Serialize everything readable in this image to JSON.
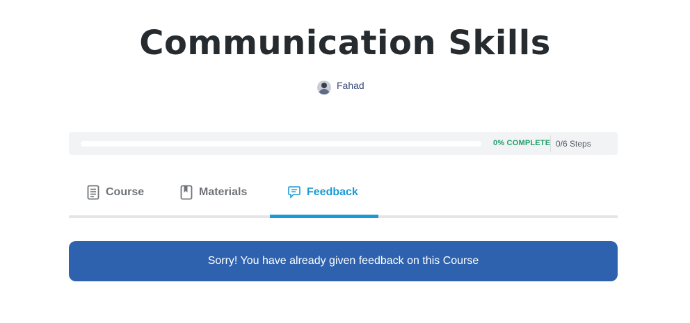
{
  "course": {
    "title": "Communication Skills",
    "author": "Fahad"
  },
  "progress": {
    "percent_label": "0% COMPLETE",
    "percent": 0,
    "steps_label": "0/6 Steps"
  },
  "tabs": [
    {
      "label": "Course",
      "icon": "document-icon",
      "active": false
    },
    {
      "label": "Materials",
      "icon": "book-icon",
      "active": false
    },
    {
      "label": "Feedback",
      "icon": "comment-icon",
      "active": true
    }
  ],
  "notice": {
    "message": "Sorry! You have already given feedback on this Course"
  },
  "colors": {
    "accent": "#1a9ad6",
    "notice_bg": "#2f62ae",
    "progress_text": "#1f9d6a"
  }
}
